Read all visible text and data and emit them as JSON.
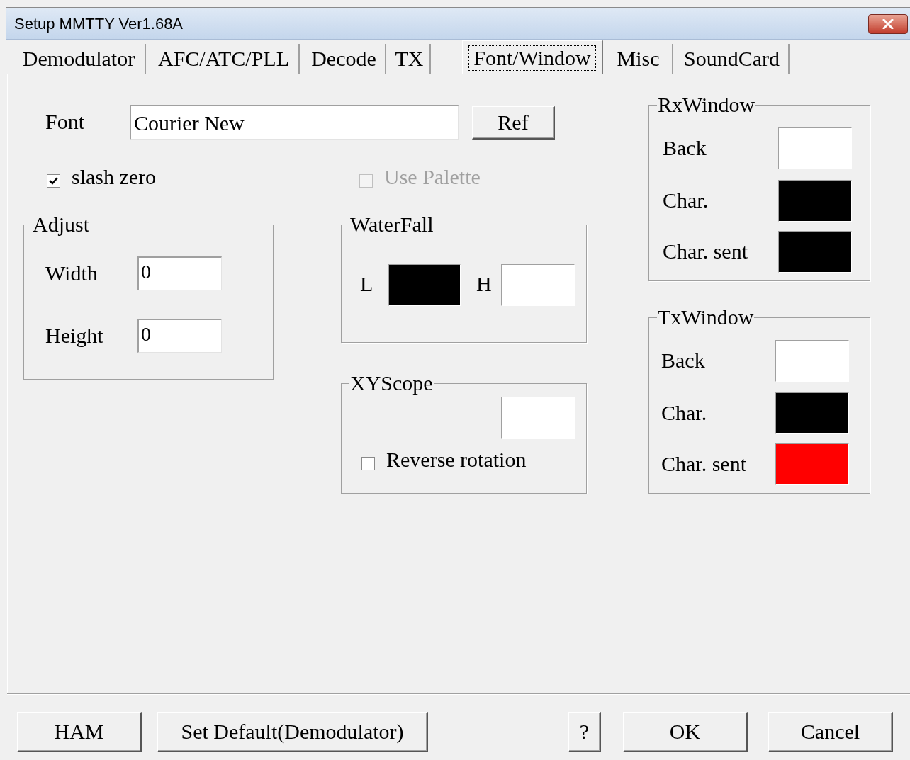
{
  "window": {
    "title": "Setup MMTTY Ver1.68A"
  },
  "tabs": [
    {
      "label": "Demodulator",
      "selected": false
    },
    {
      "label": "AFC/ATC/PLL",
      "selected": false
    },
    {
      "label": "Decode",
      "selected": false
    },
    {
      "label": "TX",
      "selected": false
    },
    {
      "label": "Font/Window",
      "selected": true
    },
    {
      "label": "Misc",
      "selected": false
    },
    {
      "label": "SoundCard",
      "selected": false
    }
  ],
  "font": {
    "label": "Font",
    "value": "Courier New",
    "button": "Ref"
  },
  "checkboxes": [
    {
      "label": "slash zero",
      "checked": true,
      "disabled": false
    },
    {
      "label": "Use Palette",
      "checked": false,
      "disabled": true
    }
  ],
  "adjust": {
    "title": "Adjust",
    "fields": [
      {
        "label": "Width",
        "value": "0"
      },
      {
        "label": "Height",
        "value": "0"
      }
    ]
  },
  "waterfall": {
    "title": "WaterFall",
    "swatches": [
      {
        "label": "L",
        "color": "#000000"
      },
      {
        "label": "H",
        "color": "#ffffff"
      }
    ]
  },
  "xyscope": {
    "title": "XYScope",
    "color": "#ffffff",
    "reverse_rotation": {
      "label": "Reverse rotation",
      "checked": false
    }
  },
  "rx_window": {
    "title": "RxWindow",
    "items": [
      {
        "label": "Back",
        "color": "#ffffff"
      },
      {
        "label": "Char.",
        "color": "#000000"
      },
      {
        "label": "Char. sent",
        "color": "#000000"
      }
    ]
  },
  "tx_window": {
    "title": "TxWindow",
    "items": [
      {
        "label": "Back",
        "color": "#ffffff"
      },
      {
        "label": "Char.",
        "color": "#000000"
      },
      {
        "label": "Char. sent",
        "color": "#ff0000"
      }
    ]
  },
  "buttons": [
    "HAM",
    "Set Default(Demodulator)",
    "?",
    "OK",
    "Cancel"
  ]
}
